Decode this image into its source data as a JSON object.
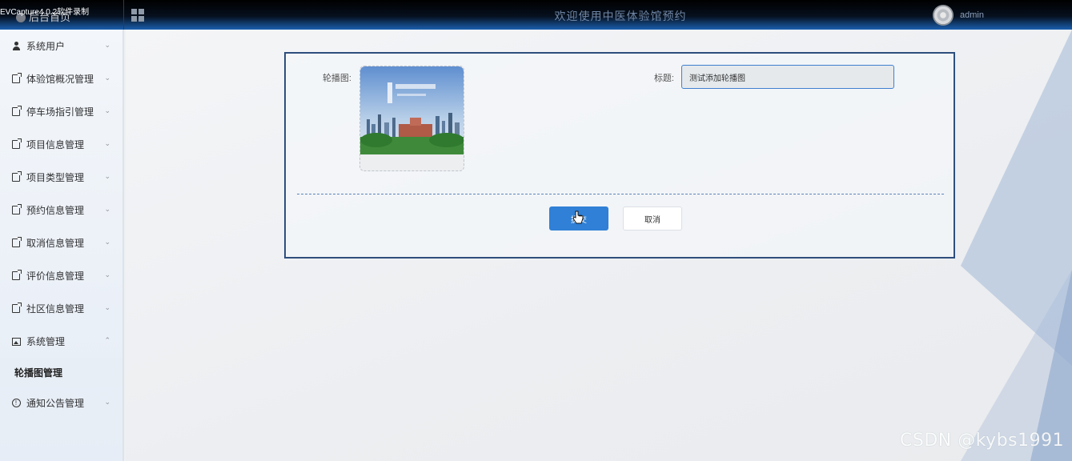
{
  "recorder_watermark": "EVCapture4.0.2软件录制",
  "header": {
    "brand": "后台首页",
    "title": "欢迎使用中医体验馆预约",
    "user": "admin"
  },
  "sidebar": {
    "items": [
      {
        "label": "系统用户",
        "icon": "user-icon",
        "chevron": "⌄"
      },
      {
        "label": "体验馆概况管理",
        "icon": "document-icon",
        "chevron": "⌄"
      },
      {
        "label": "停车场指引管理",
        "icon": "document-icon",
        "chevron": "⌄"
      },
      {
        "label": "项目信息管理",
        "icon": "document-icon",
        "chevron": "⌄"
      },
      {
        "label": "项目类型管理",
        "icon": "document-icon",
        "chevron": "⌄"
      },
      {
        "label": "预约信息管理",
        "icon": "document-icon",
        "chevron": "⌄"
      },
      {
        "label": "取消信息管理",
        "icon": "document-icon",
        "chevron": "⌄"
      },
      {
        "label": "评价信息管理",
        "icon": "document-icon",
        "chevron": "⌄"
      },
      {
        "label": "社区信息管理",
        "icon": "document-icon",
        "chevron": "⌄"
      },
      {
        "label": "系统管理",
        "icon": "picture-icon",
        "chevron": "⌃"
      },
      {
        "label": "通知公告管理",
        "icon": "info-icon",
        "chevron": "⌄"
      }
    ],
    "active_sub": "轮播图管理"
  },
  "form": {
    "image_label": "轮播图:",
    "title_label": "标题:",
    "title_value": "测试添加轮播图",
    "submit_label": "提交",
    "cancel_label": "取消"
  },
  "colors": {
    "primary": "#2f80d6",
    "card_border": "#2e4f7d",
    "dash": "#5c84bb"
  },
  "footer_watermark": "CSDN @kybs1991"
}
